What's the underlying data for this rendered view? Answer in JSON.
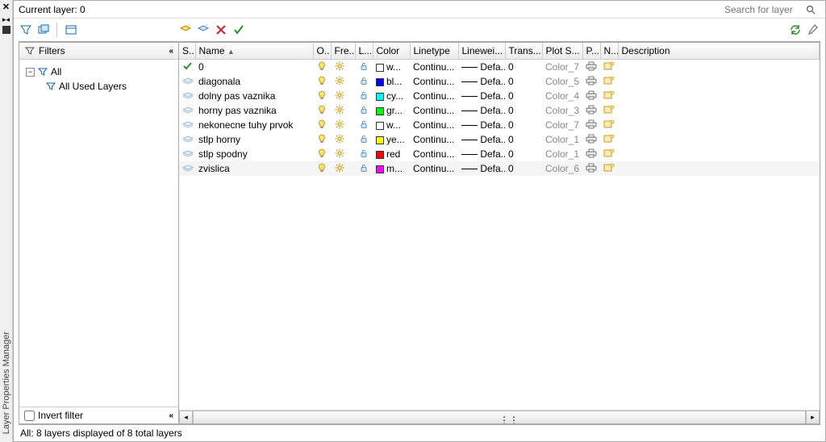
{
  "sidebar_title": "Layer Properties Manager",
  "header": {
    "current_layer_label": "Current layer: 0",
    "search_placeholder": "Search for layer"
  },
  "filters": {
    "title": "Filters",
    "all": "All",
    "all_used": "All Used Layers",
    "invert_label": "Invert filter"
  },
  "columns": {
    "status": "S..",
    "name": "Name",
    "on": "O..",
    "freeze": "Fre...",
    "lock": "L...",
    "color": "Color",
    "linetype": "Linetype",
    "lineweight": "Linewei...",
    "trans": "Trans...",
    "plotstyle": "Plot S...",
    "plot": "P...",
    "new": "N...",
    "desc": "Description"
  },
  "layers": [
    {
      "current": true,
      "name": "0",
      "color_hex": "#ffffff",
      "color_txt": "w...",
      "linetype": "Continu...",
      "lineweight": "Defa...",
      "trans": "0",
      "plotstyle": "Color_7"
    },
    {
      "current": false,
      "name": "diagonala",
      "color_hex": "#0000ff",
      "color_txt": "bl...",
      "linetype": "Continu...",
      "lineweight": "Defa...",
      "trans": "0",
      "plotstyle": "Color_5"
    },
    {
      "current": false,
      "name": "dolny pas vaznika",
      "color_hex": "#00ffff",
      "color_txt": "cy...",
      "linetype": "Continu...",
      "lineweight": "Defa...",
      "trans": "0",
      "plotstyle": "Color_4"
    },
    {
      "current": false,
      "name": "horny pas vaznika",
      "color_hex": "#00ff00",
      "color_txt": "gr...",
      "linetype": "Continu...",
      "lineweight": "Defa...",
      "trans": "0",
      "plotstyle": "Color_3"
    },
    {
      "current": false,
      "name": "nekonecne tuhy prvok",
      "color_hex": "#ffffff",
      "color_txt": "w...",
      "linetype": "Continu...",
      "lineweight": "Defa...",
      "trans": "0",
      "plotstyle": "Color_7"
    },
    {
      "current": false,
      "name": "stlp horny",
      "color_hex": "#ffff00",
      "color_txt": "ye...",
      "linetype": "Continu...",
      "lineweight": "Defa...",
      "trans": "0",
      "plotstyle": "Color_1"
    },
    {
      "current": false,
      "name": "stlp spodny",
      "color_hex": "#ff0000",
      "color_txt": "red",
      "linetype": "Continu...",
      "lineweight": "Defa...",
      "trans": "0",
      "plotstyle": "Color_1"
    },
    {
      "current": false,
      "name": "zvislica",
      "color_hex": "#ff00ff",
      "color_txt": "m...",
      "linetype": "Continu...",
      "lineweight": "Defa...",
      "trans": "0",
      "plotstyle": "Color_6",
      "selected": true
    }
  ],
  "status_bar": "All: 8 layers displayed of 8 total layers"
}
